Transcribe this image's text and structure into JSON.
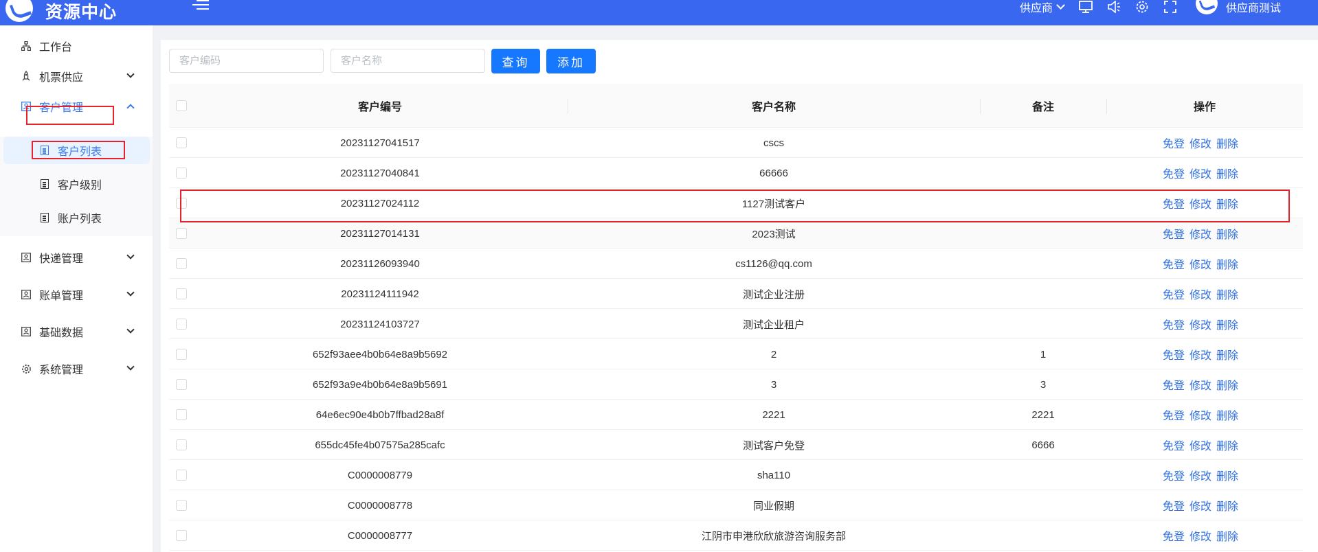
{
  "header": {
    "app_title": "资源中心",
    "role_label": "供应商",
    "user_name": "供应商测试",
    "icons": [
      "menu-fold-icon",
      "monitor-icon",
      "speaker-icon",
      "settings-icon",
      "fullscreen-icon"
    ],
    "brand_color": "#3a67f0"
  },
  "sidebar": {
    "items": [
      {
        "label": "工作台",
        "icon": "workbench-icon"
      },
      {
        "label": "机票供应",
        "icon": "rocket-icon"
      },
      {
        "label": "客户管理",
        "icon": "customer-icon"
      },
      {
        "label": "快递管理",
        "icon": "express-icon"
      },
      {
        "label": "账单管理",
        "icon": "bill-icon"
      },
      {
        "label": "基础数据",
        "icon": "data-icon"
      },
      {
        "label": "系统管理",
        "icon": "gear-icon"
      }
    ],
    "sub_items": [
      {
        "label": "客户列表"
      },
      {
        "label": "客户级别"
      },
      {
        "label": "账户列表"
      }
    ],
    "active_color": "#3a7bf0"
  },
  "toolbar": {
    "code_placeholder": "客户编码",
    "name_placeholder": "客户名称",
    "query_label": "查询",
    "add_label": "添加"
  },
  "table": {
    "headers": {
      "code": "客户编号",
      "name": "客户名称",
      "remark": "备注",
      "ops": "操作"
    },
    "actions": {
      "login": "免登",
      "edit": "修改",
      "delete": "删除"
    },
    "rows": [
      {
        "code": "20231127041517",
        "name": "cscs",
        "remark": ""
      },
      {
        "code": "20231127040841",
        "name": "66666",
        "remark": ""
      },
      {
        "code": "20231127024112",
        "name": "1127测试客户",
        "remark": ""
      },
      {
        "code": "20231127014131",
        "name": "2023测试",
        "remark": ""
      },
      {
        "code": "20231126093940",
        "name": "cs1126@qq.com",
        "remark": ""
      },
      {
        "code": "20231124111942",
        "name": "测试企业注册",
        "remark": ""
      },
      {
        "code": "20231124103727",
        "name": "测试企业租户",
        "remark": ""
      },
      {
        "code": "652f93aee4b0b64e8a9b5692",
        "name": "2",
        "remark": "1"
      },
      {
        "code": "652f93a9e4b0b64e8a9b5691",
        "name": "3",
        "remark": "3"
      },
      {
        "code": "64e6ec90e4b0b7ffbad28a8f",
        "name": "2221",
        "remark": "2221"
      },
      {
        "code": "655dc45fe4b07575a285cafc",
        "name": "测试客户免登",
        "remark": "6666"
      },
      {
        "code": "C0000008779",
        "name": "sha110",
        "remark": ""
      },
      {
        "code": "C0000008778",
        "name": "同业假期",
        "remark": ""
      },
      {
        "code": "C0000008777",
        "name": "江阴市申港欣欣旅游咨询服务部",
        "remark": ""
      }
    ]
  }
}
